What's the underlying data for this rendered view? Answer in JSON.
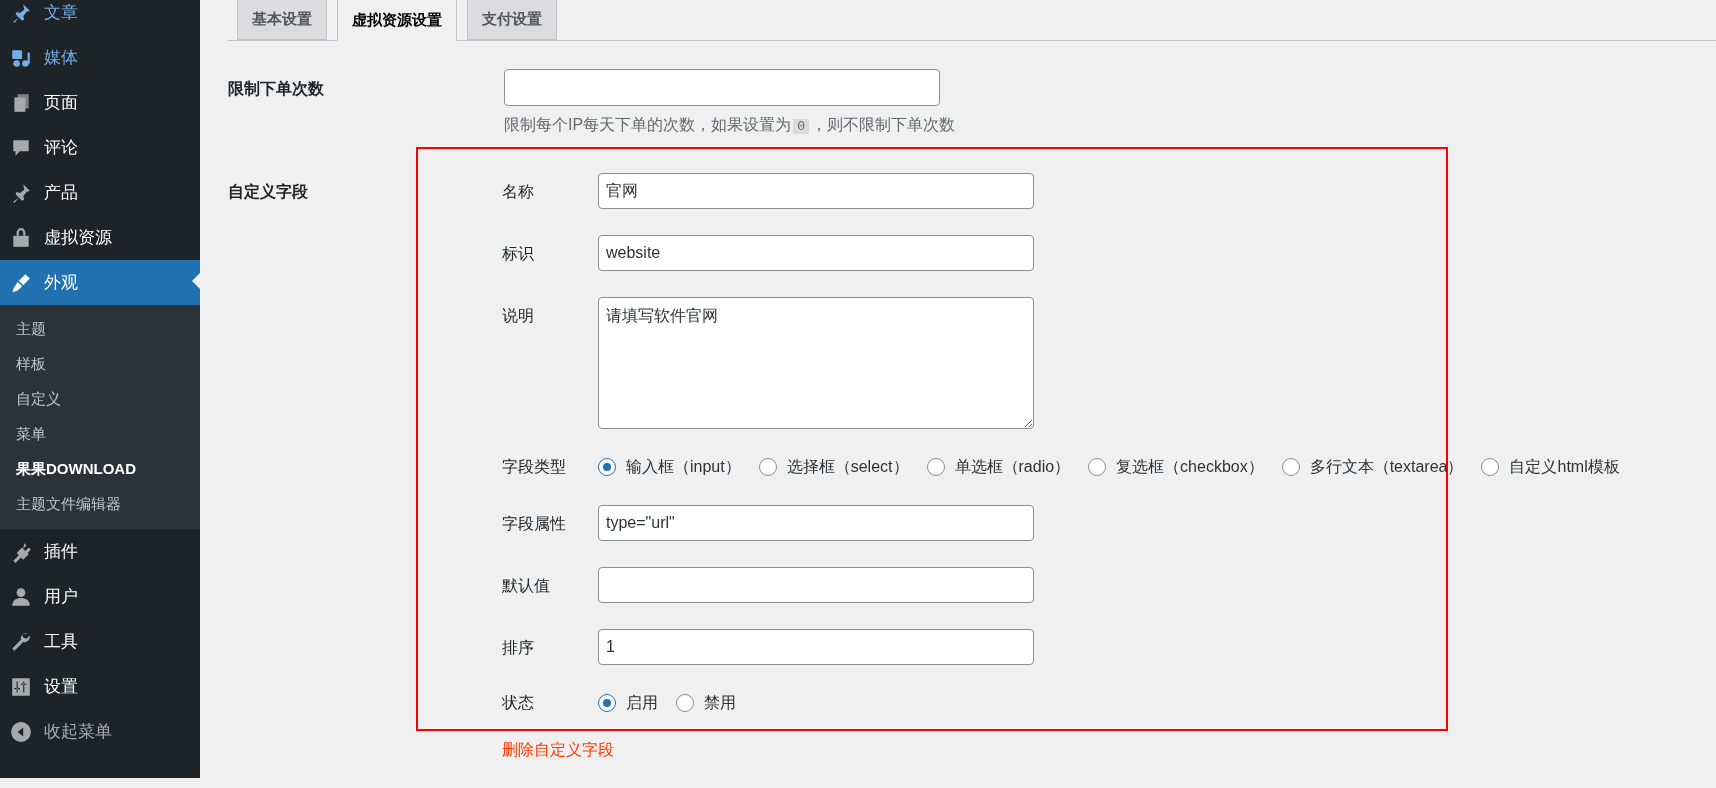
{
  "sidebar": {
    "items": [
      {
        "label": "文章",
        "highlighted": true,
        "selected": false
      },
      {
        "label": "媒体",
        "highlighted": true,
        "selected": false
      },
      {
        "label": "页面",
        "highlighted": false,
        "selected": false
      },
      {
        "label": "评论",
        "highlighted": false,
        "selected": false
      },
      {
        "label": "产品",
        "highlighted": false,
        "selected": false
      },
      {
        "label": "虚拟资源",
        "highlighted": false,
        "selected": false
      },
      {
        "label": "外观",
        "highlighted": false,
        "selected": true,
        "children": [
          {
            "label": "主题",
            "selected": false
          },
          {
            "label": "样板",
            "selected": false
          },
          {
            "label": "自定义",
            "selected": false
          },
          {
            "label": "菜单",
            "selected": false
          },
          {
            "label": "果果DOWNLOAD",
            "selected": true
          },
          {
            "label": "主题文件编辑器",
            "selected": false
          }
        ]
      },
      {
        "label": "插件",
        "highlighted": false,
        "selected": false
      },
      {
        "label": "用户",
        "highlighted": false,
        "selected": false
      },
      {
        "label": "工具",
        "highlighted": false,
        "selected": false
      },
      {
        "label": "设置",
        "highlighted": false,
        "selected": false
      },
      {
        "label": "收起菜单",
        "highlighted": false,
        "selected": false
      }
    ]
  },
  "tabs": [
    {
      "label": "基本设置",
      "selected": false
    },
    {
      "label": "虚拟资源设置",
      "selected": true
    },
    {
      "label": "支付设置",
      "selected": false
    }
  ],
  "order_limit": {
    "label": "限制下单次数",
    "hint_before": "限制每个IP每天下单的次数，如果设置为",
    "hint_code": "0",
    "hint_after": "，则不限制下单次数"
  },
  "custom_field": {
    "label": "自定义字段",
    "rows": [
      {
        "kind": "text",
        "label": "名称",
        "value": "官网"
      },
      {
        "kind": "text",
        "label": "标识",
        "value": "website"
      },
      {
        "kind": "textarea",
        "label": "说明",
        "value": "请填写软件官网"
      },
      {
        "kind": "radio",
        "label": "字段类型",
        "options": [
          {
            "label": "输入框（input）",
            "selected": true
          },
          {
            "label": "选择框（select）",
            "selected": false
          },
          {
            "label": "单选框（radio）",
            "selected": false
          },
          {
            "label": "复选框（checkbox）",
            "selected": false
          },
          {
            "label": "多行文本（textarea）",
            "selected": false
          },
          {
            "label": "自定义html模板",
            "selected": false
          }
        ]
      },
      {
        "kind": "text",
        "label": "字段属性",
        "value": "type=\"url\""
      },
      {
        "kind": "text",
        "label": "默认值"
      },
      {
        "kind": "text",
        "label": "排序",
        "value": "1"
      },
      {
        "kind": "radio",
        "label": "状态",
        "options": [
          {
            "label": "启用",
            "selected": true
          },
          {
            "label": "禁用",
            "selected": false
          }
        ]
      }
    ],
    "delete_link": "删除自定义字段"
  }
}
